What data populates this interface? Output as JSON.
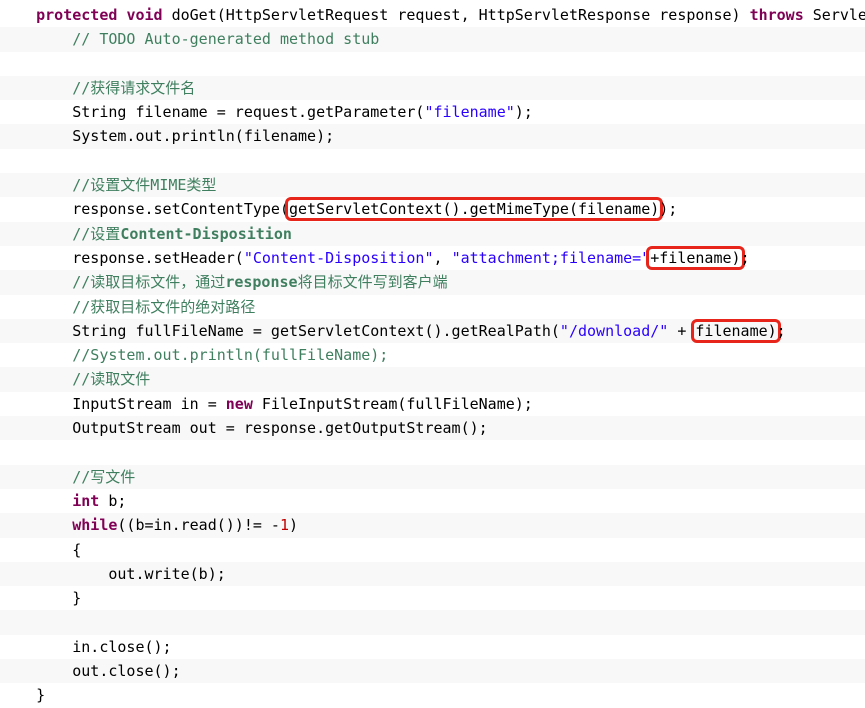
{
  "code": {
    "l1": {
      "kw1": "protected",
      "sp1": " ",
      "kw2": "void",
      "rest": " doGet(HttpServletRequest request, HttpServletResponse response) ",
      "kw3": "throws",
      "tail": " Servle"
    },
    "l2": {
      "comment": "// TODO Auto-generated method stub"
    },
    "l4": {
      "comment": "//获得请求文件名"
    },
    "l5": {
      "pre": "String filename = request.getParameter(",
      "str": "\"filename\"",
      "post": ");"
    },
    "l6": {
      "text": "System.out.println(filename);"
    },
    "l8": {
      "comment": "//设置文件MIME类型"
    },
    "l9": {
      "pre": "response.setContentType(",
      "boxed": "getServletContext().getMimeType(filename)",
      "post": ");"
    },
    "l10": {
      "comment_a": "//设置",
      "comment_b": "Content-Disposition"
    },
    "l11": {
      "pre": "response.setHeader(",
      "str1": "\"Content-Disposition\"",
      "mid": ", ",
      "str2": "\"attachment;filename=\"",
      "boxed": "+filename)",
      "post": ";"
    },
    "l12": {
      "comment_a": "//读取目标文件，通过",
      "comment_b": "response",
      "comment_c": "将目标文件写到客户端"
    },
    "l13": {
      "comment": "//获取目标文件的绝对路径"
    },
    "l14": {
      "pre": "String fullFileName = getServletContext().getRealPath(",
      "str": "\"/download/\"",
      "mid": " + ",
      "boxed": "filename)",
      "post": ";"
    },
    "l15": {
      "comment": "//System.out.println(fullFileName);"
    },
    "l16": {
      "comment": "//读取文件"
    },
    "l17": {
      "pre": "InputStream in = ",
      "kw": "new",
      "post": " FileInputStream(fullFileName);"
    },
    "l18": {
      "text": "OutputStream out = response.getOutputStream();"
    },
    "l20": {
      "comment": "//写文件"
    },
    "l21": {
      "kw": "int",
      "post": " b;"
    },
    "l22": {
      "kw": "while",
      "pre": "((b=in.read())!= -",
      "num": "1",
      "post": ")"
    },
    "l23": {
      "text": "{"
    },
    "l24": {
      "text": "out.write(b);"
    },
    "l25": {
      "text": "}"
    },
    "l27": {
      "text": "in.close();"
    },
    "l28": {
      "text": "out.close();"
    },
    "l29": {
      "text": "}"
    }
  }
}
